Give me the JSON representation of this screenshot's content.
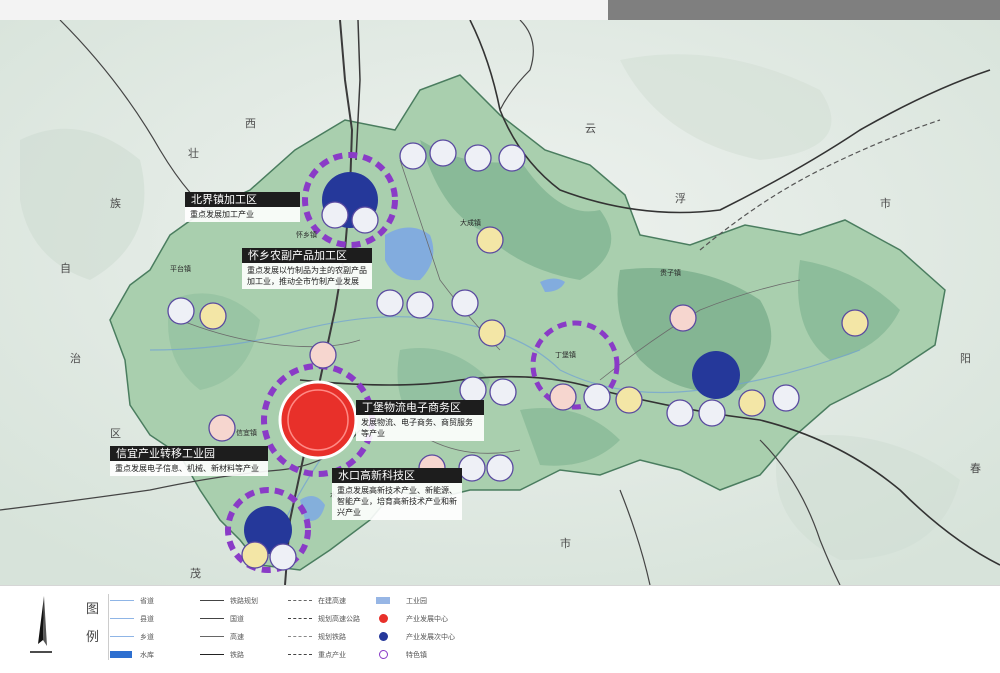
{
  "map": {
    "province_labels": [
      "西",
      "壮",
      "族",
      "自",
      "治",
      "区",
      "云",
      "浮",
      "市",
      "阳",
      "春",
      "茂",
      "市"
    ],
    "town_labels": [
      "平台镇",
      "怀乡镇",
      "丁堡镇",
      "水口镇",
      "信宜镇",
      "大成镇",
      "贵子镇"
    ],
    "callouts": [
      {
        "title": "北界镇加工区",
        "desc": "重点发展加工产业"
      },
      {
        "title": "怀乡农副产品加工区",
        "desc": "重点发展以竹制品为主的农副产品加工业，推动全市竹制产业发展"
      },
      {
        "title": "丁堡物流电子商务区",
        "desc": "发展物流、电子商务、商贸服务等产业"
      },
      {
        "title": "信宜产业转移工业园",
        "desc": "重点发展电子信息、机械、新材料等产业"
      },
      {
        "title": "水口高新科技区",
        "desc": "重点发展高新技术产业、新能源、智能产业，培育高新技术产业和新兴产业"
      }
    ]
  },
  "legend": {
    "title_chars": [
      "图",
      "例"
    ],
    "col1": [
      "省道",
      "县道",
      "乡道",
      "水库"
    ],
    "col2": [
      "铁路规划",
      "国道",
      "高速",
      "铁路"
    ],
    "col3": [
      "在建高速",
      "规划高速公路",
      "规划铁路",
      "重点产业"
    ],
    "col4": [
      "工业园",
      "产业发展中心",
      "产业发展次中心",
      "特色镇"
    ]
  },
  "colors": {
    "land": "#a9cfae",
    "land_dark": "#6fa889",
    "outside": "#dfe8e2",
    "water": "#7ba6e6",
    "core_red": "#e8302a",
    "node_blue": "#25389a",
    "ring_purple": "#8a3bc7"
  }
}
